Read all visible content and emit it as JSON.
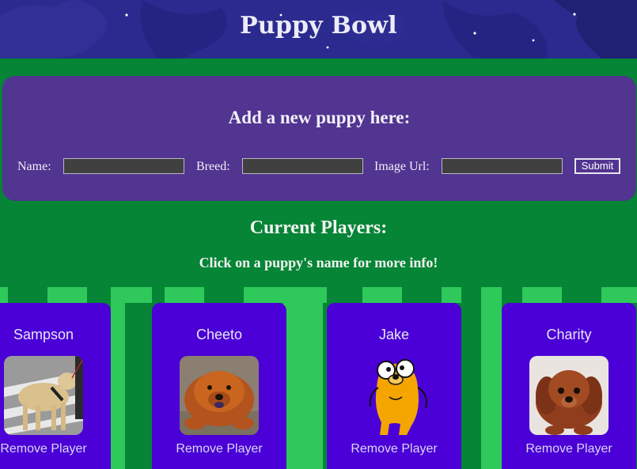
{
  "header": {
    "title": "Puppy Bowl"
  },
  "form": {
    "heading": "Add a new puppy here:",
    "name_label": "Name:",
    "breed_label": "Breed:",
    "image_label": "Image Url:",
    "name_value": "",
    "breed_value": "",
    "image_value": "",
    "submit_label": "Submit"
  },
  "players": {
    "heading": "Current Players:",
    "subheading": "Click on a puppy's name for more info!"
  },
  "cards": [
    {
      "name": "Sampson",
      "remove_label": "Remove Player",
      "image": "labrador-on-crosswalk-photo"
    },
    {
      "name": "Cheeto",
      "remove_label": "Remove Player",
      "image": "chow-chow-on-gravel-photo"
    },
    {
      "name": "Jake",
      "remove_label": "Remove Player",
      "image": "cartoon-yellow-dog-illustration"
    },
    {
      "name": "Charity",
      "remove_label": "Remove Player",
      "image": "red-puppy-photo"
    }
  ],
  "colors": {
    "background": "#058535",
    "stripe_light": "#2fc95b",
    "header": "#2a2a8c",
    "form_panel": "#523491",
    "card": "#4a00d6"
  }
}
